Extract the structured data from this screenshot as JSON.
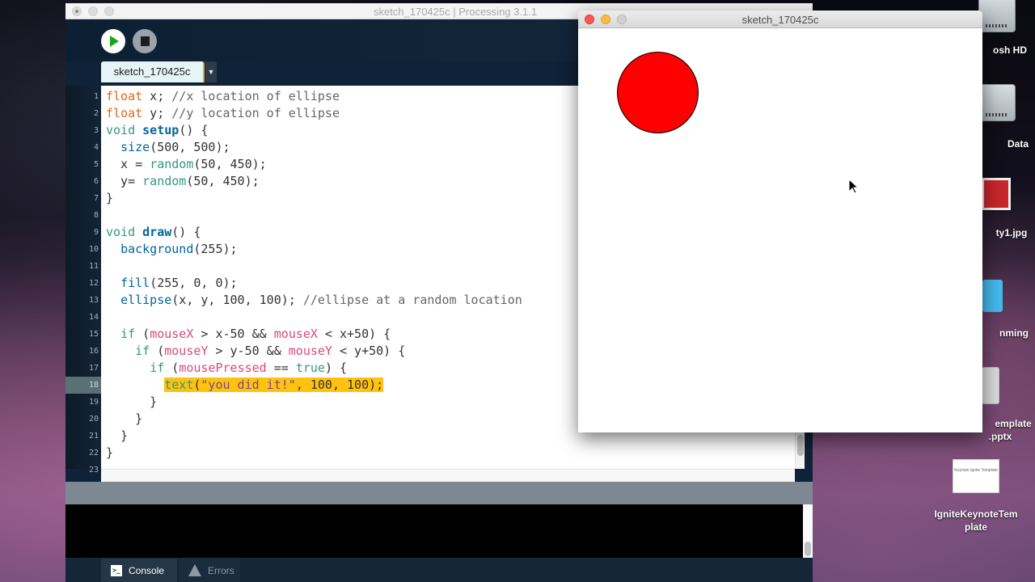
{
  "desktop": {
    "icons": [
      {
        "label": "osh HD",
        "kind": "hard-drive"
      },
      {
        "label": "Data",
        "kind": "hard-drive"
      },
      {
        "label": "ty1.jpg",
        "kind": "photo"
      },
      {
        "label": "nming",
        "kind": "folder"
      },
      {
        "label": "emplate",
        "label2": ".pptx",
        "kind": "pptx"
      },
      {
        "label": "IgniteKeynoteTem",
        "label2": "plate",
        "kind": "keynote",
        "thumb_text": "Keynote Ignite Template"
      }
    ]
  },
  "ide": {
    "window_title": "sketch_170425c | Processing 3.1.1",
    "run_label": "Run",
    "stop_label": "Stop",
    "tab_name": "sketch_170425c",
    "tab_menu_glyph": "▼",
    "active_line": 18,
    "highlight_color": "#ffc20e",
    "code_lines": [
      [
        {
          "t": "float",
          "c": "k-type"
        },
        {
          "t": " x; "
        },
        {
          "t": "//x location of ellipse",
          "c": "k-com"
        }
      ],
      [
        {
          "t": "float",
          "c": "k-type"
        },
        {
          "t": " y; "
        },
        {
          "t": "//y location of ellipse",
          "c": "k-com"
        }
      ],
      [
        {
          "t": "void ",
          "c": "k-kw"
        },
        {
          "t": "setup",
          "c": "k-fn-bold"
        },
        {
          "t": "() {"
        }
      ],
      [
        {
          "t": "  "
        },
        {
          "t": "size",
          "c": "k-fn"
        },
        {
          "t": "(500, 500);"
        }
      ],
      [
        {
          "t": "  x = "
        },
        {
          "t": "random",
          "c": "k-call"
        },
        {
          "t": "(50, 450);"
        }
      ],
      [
        {
          "t": "  y= "
        },
        {
          "t": "random",
          "c": "k-call"
        },
        {
          "t": "(50, 450);"
        }
      ],
      [
        {
          "t": "}"
        }
      ],
      [
        {
          "t": ""
        }
      ],
      [
        {
          "t": "void ",
          "c": "k-kw"
        },
        {
          "t": "draw",
          "c": "k-fn-bold"
        },
        {
          "t": "() {"
        }
      ],
      [
        {
          "t": "  "
        },
        {
          "t": "background",
          "c": "k-fn"
        },
        {
          "t": "(255);"
        }
      ],
      [
        {
          "t": ""
        }
      ],
      [
        {
          "t": "  "
        },
        {
          "t": "fill",
          "c": "k-fn"
        },
        {
          "t": "(255, 0, 0);"
        }
      ],
      [
        {
          "t": "  "
        },
        {
          "t": "ellipse",
          "c": "k-fn"
        },
        {
          "t": "(x, y, 100, 100); "
        },
        {
          "t": "//ellipse at a random location",
          "c": "k-com"
        }
      ],
      [
        {
          "t": ""
        }
      ],
      [
        {
          "t": "  "
        },
        {
          "t": "if",
          "c": "k-kw"
        },
        {
          "t": " ("
        },
        {
          "t": "mouseX",
          "c": "k-var"
        },
        {
          "t": " > x-50 && "
        },
        {
          "t": "mouseX",
          "c": "k-var"
        },
        {
          "t": " < x+50) {"
        }
      ],
      [
        {
          "t": "    "
        },
        {
          "t": "if",
          "c": "k-kw"
        },
        {
          "t": " ("
        },
        {
          "t": "mouseY",
          "c": "k-var"
        },
        {
          "t": " > y-50 && "
        },
        {
          "t": "mouseY",
          "c": "k-var"
        },
        {
          "t": " < y+50) {"
        }
      ],
      [
        {
          "t": "      "
        },
        {
          "t": "if",
          "c": "k-kw"
        },
        {
          "t": " ("
        },
        {
          "t": "mousePressed",
          "c": "k-var"
        },
        {
          "t": " == "
        },
        {
          "t": "true",
          "c": "k-lit"
        },
        {
          "t": ") {"
        }
      ],
      [
        {
          "t": "        "
        },
        {
          "t": "text",
          "c": "k-call",
          "hl": true
        },
        {
          "t": "(",
          "hl": true
        },
        {
          "t": "\"you did it!\"",
          "c": "k-str",
          "hl": true
        },
        {
          "t": ", 100, 100);",
          "hl": true
        }
      ],
      [
        {
          "t": "      }"
        }
      ],
      [
        {
          "t": "    }"
        }
      ],
      [
        {
          "t": "  }"
        }
      ],
      [
        {
          "t": "}"
        }
      ]
    ],
    "footer": {
      "console_label": "Console",
      "errors_label": "Errors",
      "console_glyph": ">_"
    }
  },
  "sketch_window": {
    "title": "sketch_170425c",
    "canvas_background": "#ffffff",
    "ellipse_fill": "#ff0000",
    "ellipse_stroke": "#000000"
  }
}
